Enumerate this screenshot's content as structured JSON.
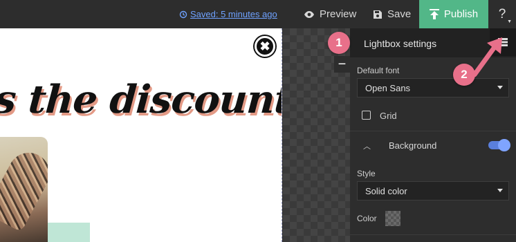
{
  "topbar": {
    "saved_text": "Saved: 5 minutes ago",
    "preview_label": "Preview",
    "save_label": "Save",
    "publish_label": "Publish",
    "help_label": "?"
  },
  "canvas": {
    "headline": "s the discount!",
    "close_symbol": "✖"
  },
  "panel": {
    "title": "Lightbox settings",
    "default_font_label": "Default font",
    "default_font_value": "Open Sans",
    "grid_label": "Grid",
    "background_label": "Background",
    "background_enabled": true,
    "style_label": "Style",
    "style_value": "Solid color",
    "color_label": "Color"
  },
  "callouts": {
    "badge_1": "1",
    "badge_2": "2"
  },
  "colors": {
    "accent_green": "#52b788",
    "callout_pink": "#e8708a",
    "link_blue": "#6fa2ff",
    "panel_bg": "#2d2d2d",
    "headline_shadow": "#e39a86"
  },
  "icons": [
    "history-icon",
    "eye-icon",
    "save-icon",
    "upload-icon",
    "help-icon",
    "close-circle-icon",
    "minus-icon",
    "list-icon",
    "chevron-up-icon",
    "dropdown-caret-icon"
  ]
}
